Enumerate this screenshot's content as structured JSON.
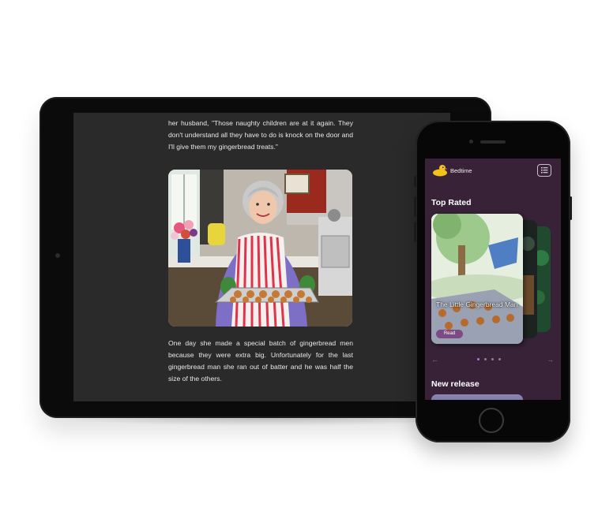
{
  "story": {
    "paragraph1": "her husband, \"Those naughty children are at it again. They don't understand all they have to do is knock on the door and I'll give them my gingerbread treats.\"",
    "paragraph2": "One day she made a special batch of gingerbread men because they were extra big. Unfortunately for the last gingerbread man she ran out of batter and he was half the size of the others."
  },
  "app": {
    "name": "Bedtime",
    "logo_icon": "duck-icon",
    "menu_icon": "list-icon",
    "top_rated": {
      "title": "Top Rated",
      "cards": [
        {
          "title": "The Little Gingerbread Man",
          "button": "Read"
        }
      ],
      "prev_icon": "arrow-left-icon",
      "next_icon": "arrow-right-icon",
      "dots": 4,
      "active_dot": 0
    },
    "new_release": {
      "title": "New release"
    }
  },
  "colors": {
    "app_background": "#372238",
    "accent": "#7c4a84",
    "tablet_screen": "#2b2a2a"
  }
}
